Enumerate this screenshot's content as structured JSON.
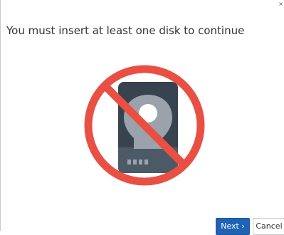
{
  "dialog": {
    "title": "You must insert at least one disk to continue",
    "close_glyph": "×",
    "illustration_icon": "no-disk-icon",
    "next_label": "Next ›",
    "cancel_label": "Cancel"
  },
  "colors": {
    "title_text": "#333333",
    "prohibition_red": "#e94f43",
    "disk_dark": "#37434f",
    "disk_mid": "#4c5966",
    "disk_light": "#9aa3ac",
    "primary_button": "#1e63b5"
  }
}
